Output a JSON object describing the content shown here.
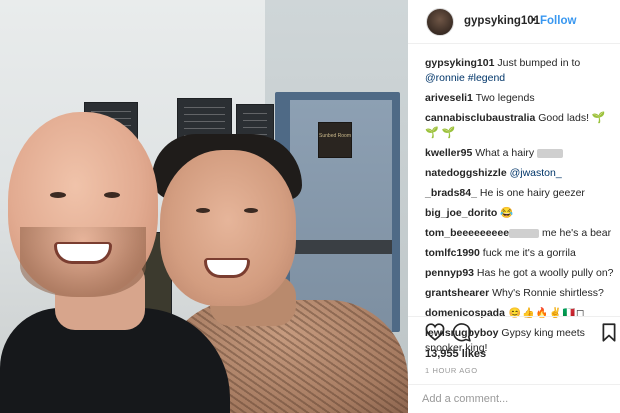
{
  "header": {
    "username": "gypsyking101",
    "separator": "•",
    "follow_label": "Follow"
  },
  "photo": {
    "door_sign": "Sunbed Room"
  },
  "comments": [
    {
      "user": "gypsyking101",
      "text_before": " Just bumped in to ",
      "mention": "@ronnie",
      "text_after": " ",
      "hashtag": "#legend"
    },
    {
      "user": "ariveseli1",
      "text": " Two legends"
    },
    {
      "user": "cannabisclubaustralia",
      "text": " Good lads! ",
      "emoji": "🌱 🌱 🌱"
    },
    {
      "user": "kweller95",
      "text": " What a hairy "
    },
    {
      "user": "natedoggshizzle",
      "mention": " @jwaston_"
    },
    {
      "user": "_brads84_",
      "text": " He is one hairy geezer"
    },
    {
      "user": "big_joe_dorito",
      "emoji": " 😂"
    },
    {
      "user": "tom_beeeeeeeee",
      "text": " me he's a bear"
    },
    {
      "user": "tomlfc1990",
      "text": " fuck me it's a gorrila"
    },
    {
      "user": "pennyp93",
      "text": " Has he got a woolly pully on?"
    },
    {
      "user": "grantshearer",
      "text": " Why's Ronnie shirtless?"
    },
    {
      "user": "domenicospada",
      "emoji": " 😊👍🔥✌🇮🇹◻"
    },
    {
      "user": "lewisrugbyboy",
      "text": " Gypsy king meets snooker king!"
    }
  ],
  "footer": {
    "likes": "13,955 likes",
    "time": "1 HOUR AGO",
    "add_comment_placeholder": "Add a comment..."
  },
  "icons": {
    "like": "heart-icon",
    "comment": "comment-icon",
    "save": "bookmark-icon"
  },
  "colors": {
    "link_blue": "#3897f0",
    "mention": "#003569",
    "text": "#262626",
    "muted": "#999999"
  }
}
